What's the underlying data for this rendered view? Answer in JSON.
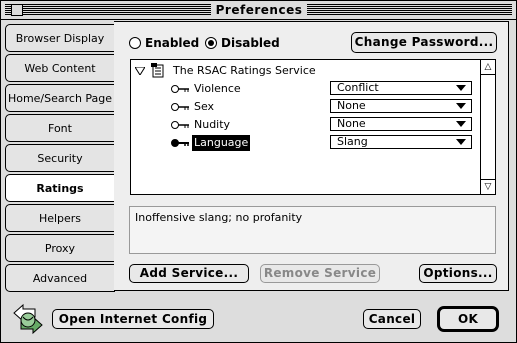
{
  "window": {
    "title": "Preferences"
  },
  "tabs": [
    {
      "label": "Browser Display",
      "active": false
    },
    {
      "label": "Web Content",
      "active": false
    },
    {
      "label": "Home/Search Page",
      "active": false
    },
    {
      "label": "Font",
      "active": false
    },
    {
      "label": "Security",
      "active": false
    },
    {
      "label": "Ratings",
      "active": true
    },
    {
      "label": "Helpers",
      "active": false
    },
    {
      "label": "Proxy",
      "active": false
    },
    {
      "label": "Advanced",
      "active": false
    }
  ],
  "ratings": {
    "enabled_label": "Enabled",
    "disabled_label": "Disabled",
    "selected": "Disabled",
    "change_password_label": "Change Password...",
    "service": {
      "name": "The RSAC Ratings Service",
      "categories": [
        {
          "label": "Violence",
          "value": "Conflict",
          "selected": false
        },
        {
          "label": "Sex",
          "value": "None",
          "selected": false
        },
        {
          "label": "Nudity",
          "value": "None",
          "selected": false
        },
        {
          "label": "Language",
          "value": "Slang",
          "selected": true
        }
      ]
    },
    "description": "Inoffensive slang; no profanity",
    "add_service_label": "Add Service...",
    "remove_service_label": "Remove Service",
    "options_label": "Options..."
  },
  "footer": {
    "open_internet_config_label": "Open Internet Config",
    "cancel_label": "Cancel",
    "ok_label": "OK"
  },
  "icons": {
    "expand": "disclosure-triangle-icon",
    "service": "scroll-document-icon",
    "category": "key-icon",
    "internet_config": "internet-config-icon"
  }
}
